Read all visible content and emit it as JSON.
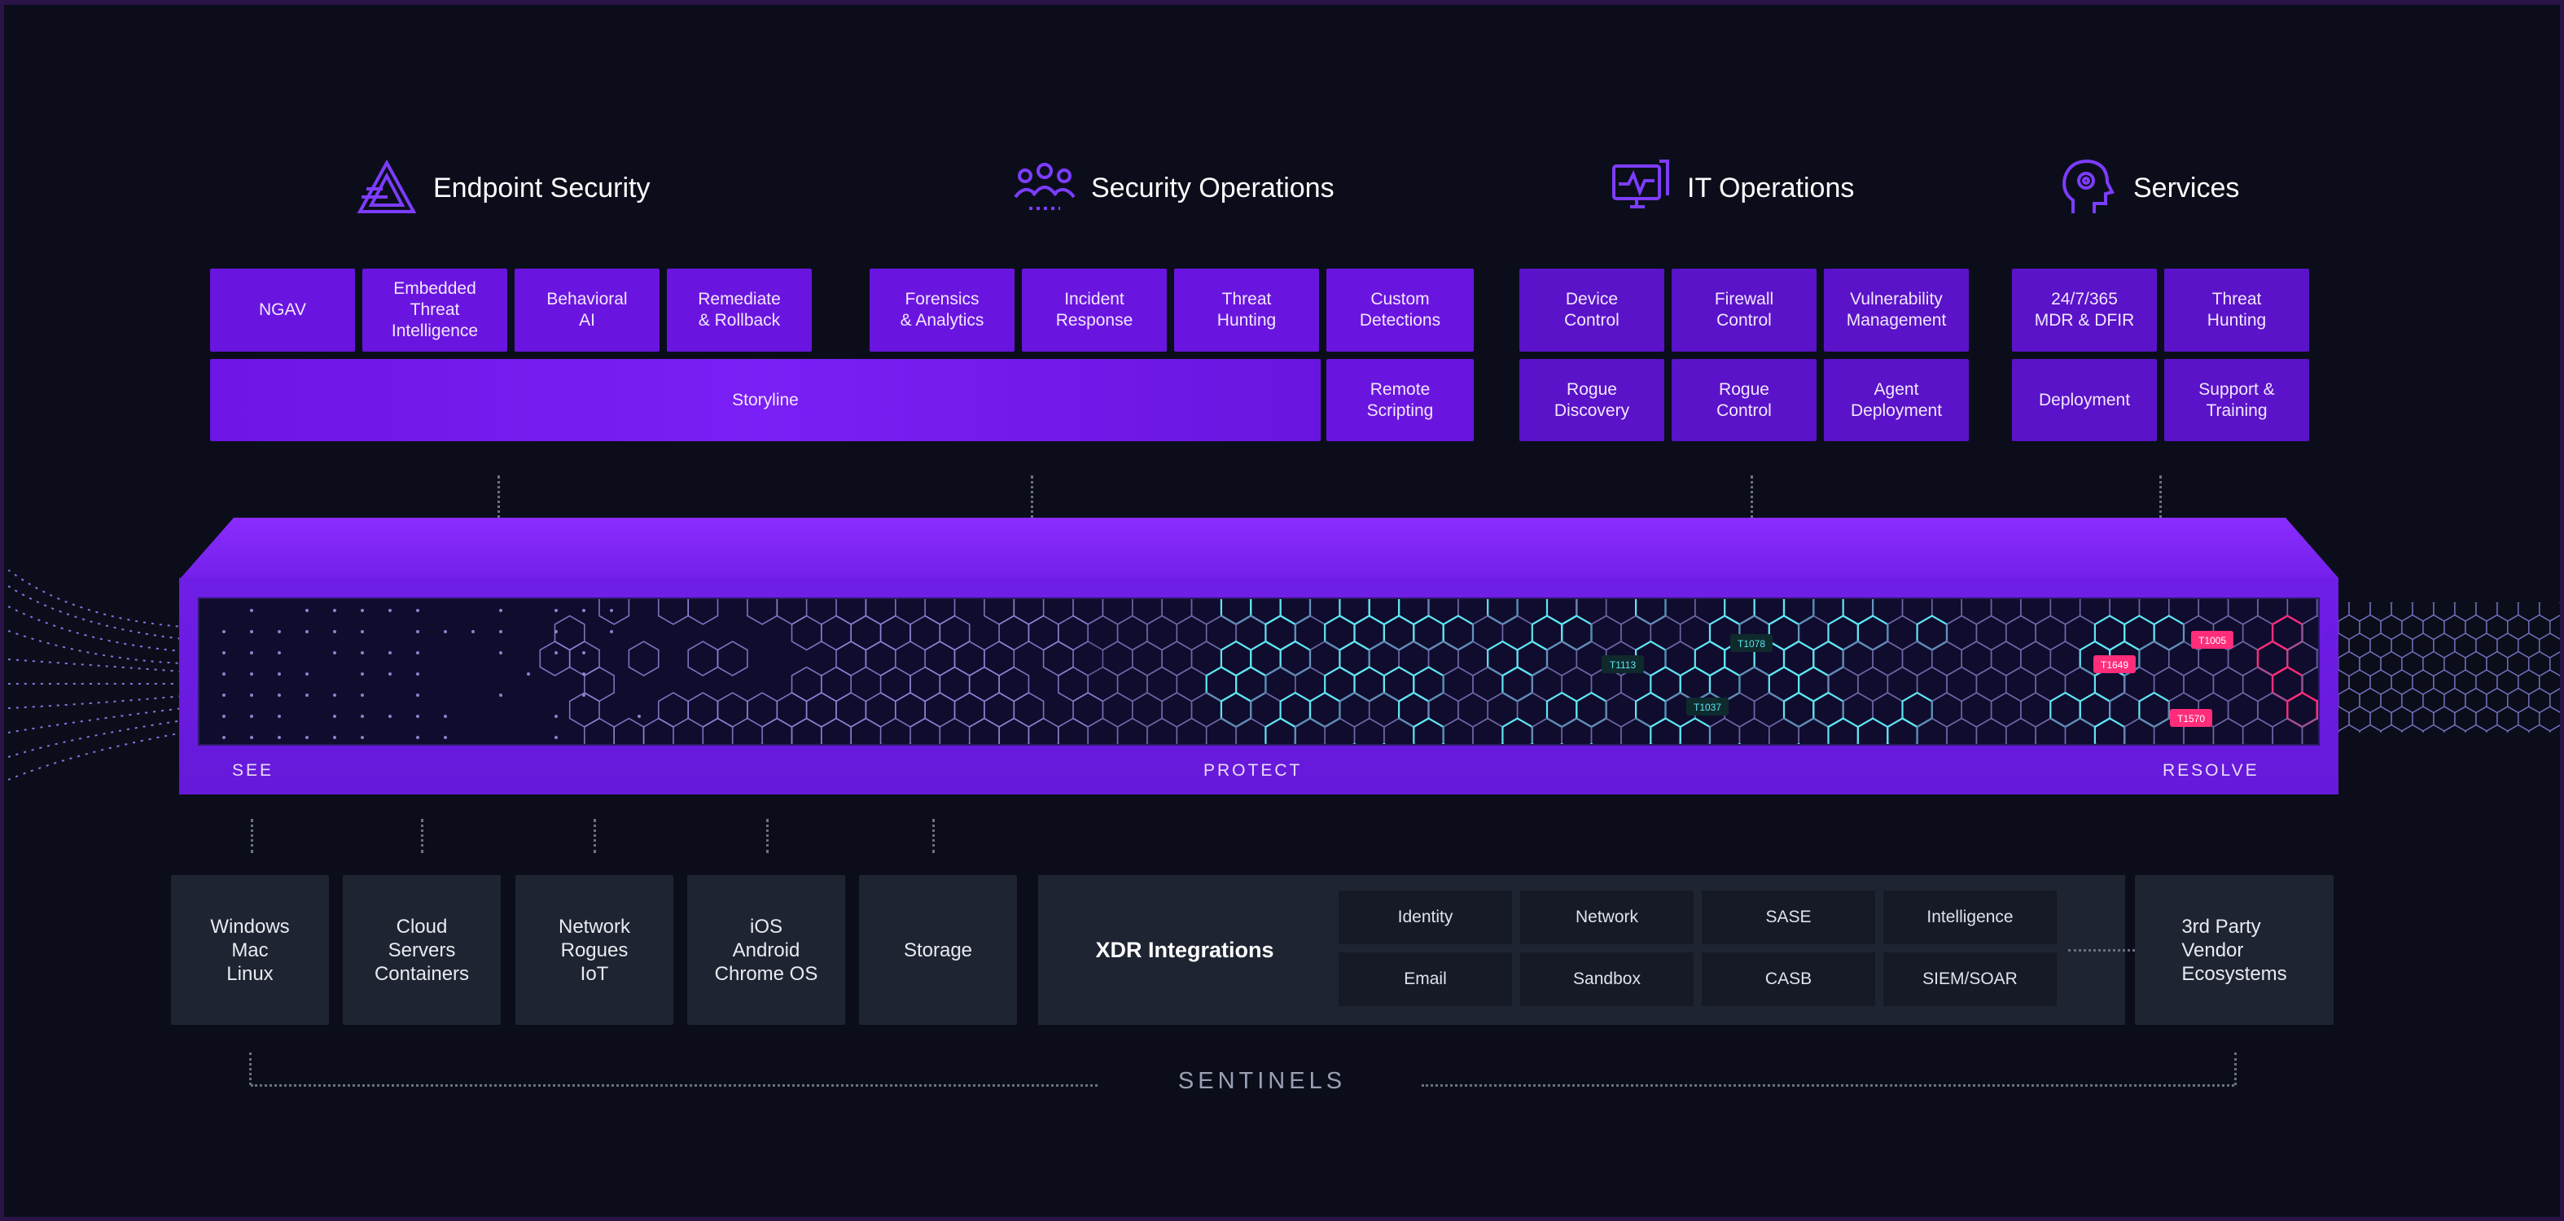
{
  "categories": [
    {
      "id": "endpoint",
      "label": "Endpoint Security",
      "icon": "triangle-logo-icon"
    },
    {
      "id": "secops",
      "label": "Security Operations",
      "icon": "people-group-icon"
    },
    {
      "id": "itops",
      "label": "IT Operations",
      "icon": "monitor-pulse-icon"
    },
    {
      "id": "services",
      "label": "Services",
      "icon": "head-gear-icon"
    }
  ],
  "tiles": {
    "ngav": "NGAV",
    "embedded": "Embedded\nThreat\nIntelligence",
    "behavioral": "Behavioral\nAI",
    "remediate": "Remediate\n& Rollback",
    "forensics": "Forensics\n& Analytics",
    "incident": "Incident\nResponse",
    "threat_hunting": "Threat\nHunting",
    "custom": "Custom\nDetections",
    "storyline": "Storyline",
    "remote": "Remote\nScripting",
    "device": "Device\nControl",
    "firewall": "Firewall\nControl",
    "vuln": "Vulnerability\nManagement",
    "rogue_disc": "Rogue\nDiscovery",
    "rogue_ctrl": "Rogue\nControl",
    "agent": "Agent\nDeployment",
    "mdr": "24/7/365\nMDR & DFIR",
    "svc_hunting": "Threat\nHunting",
    "deployment": "Deployment",
    "support": "Support &\nTraining"
  },
  "platform": {
    "see": "SEE",
    "protect": "PROTECT",
    "resolve": "RESOLVE",
    "tags": [
      "T1113",
      "T1078",
      "T1037",
      "T1005",
      "T1649",
      "T1570"
    ],
    "accent_cyan": "#5fe6f2",
    "accent_pink": "#ff2d7a"
  },
  "surfaces": [
    {
      "id": "os",
      "label": "Windows\nMac\nLinux"
    },
    {
      "id": "cloud",
      "label": "Cloud\nServers\nContainers"
    },
    {
      "id": "network",
      "label": "Network\nRogues\nIoT"
    },
    {
      "id": "mobile",
      "label": "iOS\nAndroid\nChrome OS"
    },
    {
      "id": "storage",
      "label": "Storage"
    }
  ],
  "xdr": {
    "title": "XDR Integrations",
    "items": [
      "Identity",
      "Network",
      "SASE",
      "Intelligence",
      "Email",
      "Sandbox",
      "CASB",
      "SIEM/SOAR"
    ],
    "third_party": "3rd Party\nVendor\nEcosystems"
  },
  "footer": {
    "sentinels": "SENTINELS"
  },
  "colors": {
    "background": "#0b0e1a",
    "tile": "#6a15df",
    "bottom_tile": "#1f2432"
  }
}
